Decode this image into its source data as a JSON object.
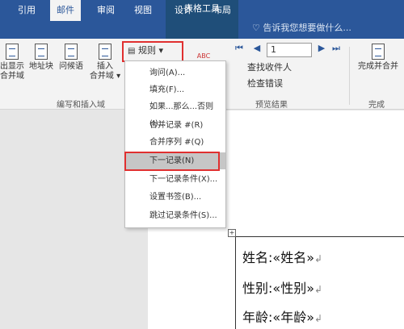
{
  "context_tab_group": "表格工具",
  "tabs": [
    "引用",
    "邮件",
    "审阅",
    "视图",
    "设计",
    "布局"
  ],
  "active_tab_index": 1,
  "tell_me": "告诉我您想要做什么...",
  "ribbon": {
    "left_buttons": [
      "出显示\n合并域",
      "地址块",
      "问候语",
      "插入\n合并域 ▾"
    ],
    "rules_button": "规则 ▾",
    "group_write_insert": "编写和插入域",
    "record_input": "1",
    "find_recipient": "查找收件人",
    "check_errors": "检查错误",
    "group_preview": "预览结果",
    "finish_merge": "完成并合并",
    "group_finish": "完成"
  },
  "menu": {
    "items": [
      "询问(A)...",
      "填充(F)...",
      "如果...那么...否则(I)...",
      "合并记录 #(R)",
      "合并序列 #(Q)",
      "下一记录(N)",
      "下一记录条件(X)...",
      "设置书签(B)...",
      "跳过记录条件(S)..."
    ],
    "selected_index": 5
  },
  "document": {
    "rows": [
      {
        "label": "姓名:",
        "field": "«姓名»"
      },
      {
        "label": "性别:",
        "field": "«性别»"
      },
      {
        "label": "年龄:",
        "field": "«年龄»"
      }
    ]
  },
  "colors": {
    "word_blue": "#2b579a",
    "highlight_red": "#e03030"
  }
}
